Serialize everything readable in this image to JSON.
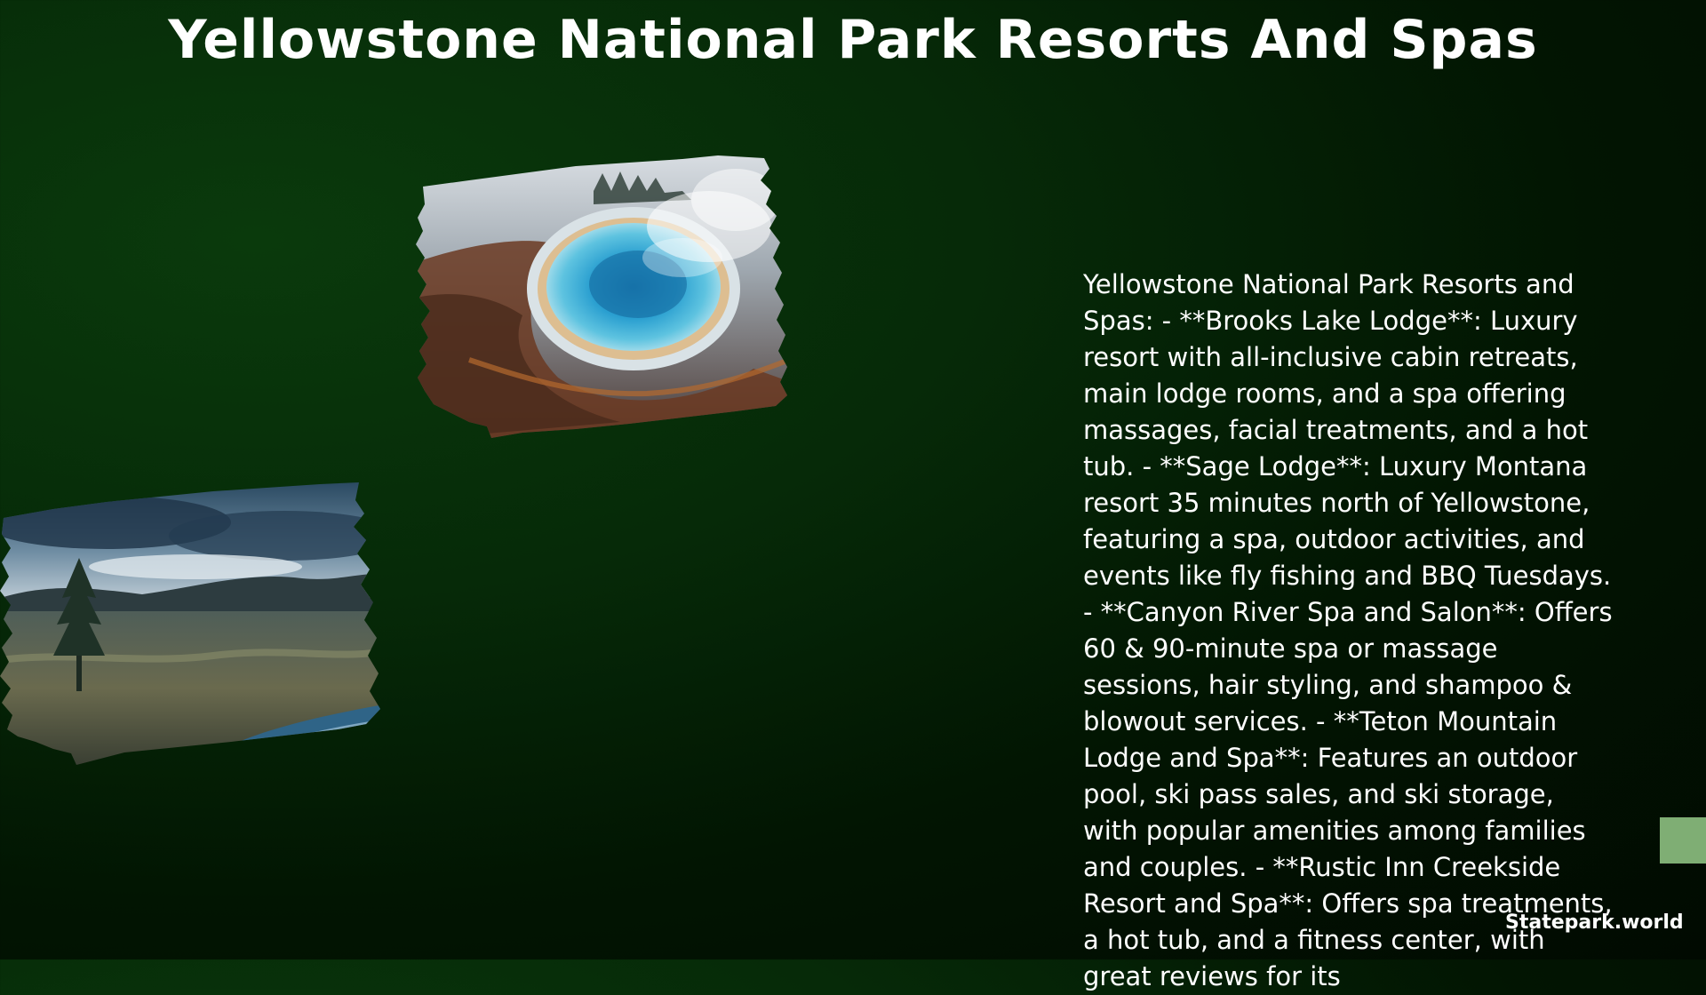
{
  "page": {
    "title": "Yellowstone National Park Resorts And Spas",
    "description": "Yellowstone National Park Resorts and Spas:  - **Brooks Lake Lodge**: Luxury resort with all-inclusive cabin retreats, main lodge rooms, and a spa offering massages, facial treatments, and a hot tub. - **Sage Lodge**: Luxury Montana resort 35 minutes north of Yellowstone, featuring a spa, outdoor activities, and events like fly fishing and BBQ Tuesdays. - **Canyon River Spa and Salon**: Offers 60 & 90-minute spa or massage sessions, hair styling, and shampoo & blowout services. - **Teton Mountain Lodge and Spa**: Features an outdoor pool, ski pass sales, and ski storage, with popular amenities among families and couples. - **Rustic Inn Creekside Resort and Spa**: Offers spa treatments, a hot tub, and a fitness center, with great reviews for its",
    "watermark": "Statepark.world"
  },
  "colors": {
    "background_dark": "#010a01",
    "background_green": "#0a3a0c",
    "accent_tab": "#7fae74",
    "text": "#ffffff"
  }
}
